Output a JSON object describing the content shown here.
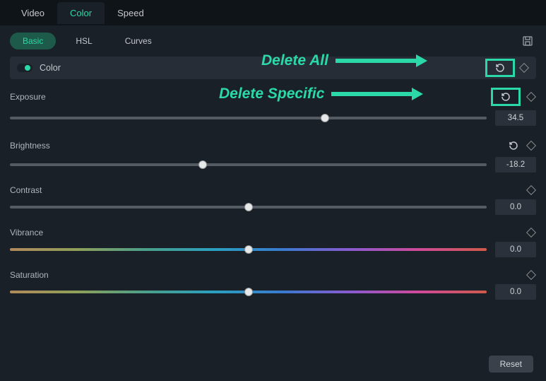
{
  "top_tabs": {
    "video": "Video",
    "color": "Color",
    "speed": "Speed"
  },
  "sub_tabs": {
    "basic": "Basic",
    "hsl": "HSL",
    "curves": "Curves"
  },
  "section_title": "Color",
  "annotations": {
    "delete_all": "Delete All",
    "delete_specific": "Delete Specific"
  },
  "properties": {
    "exposure": {
      "label": "Exposure",
      "value": "34.5",
      "thumb_pct": 66
    },
    "brightness": {
      "label": "Brightness",
      "value": "-18.2",
      "thumb_pct": 40.5
    },
    "contrast": {
      "label": "Contrast",
      "value": "0.0",
      "thumb_pct": 50
    },
    "vibrance": {
      "label": "Vibrance",
      "value": "0.0",
      "thumb_pct": 50
    },
    "saturation": {
      "label": "Saturation",
      "value": "0.0",
      "thumb_pct": 50
    }
  },
  "footer": {
    "reset": "Reset"
  }
}
